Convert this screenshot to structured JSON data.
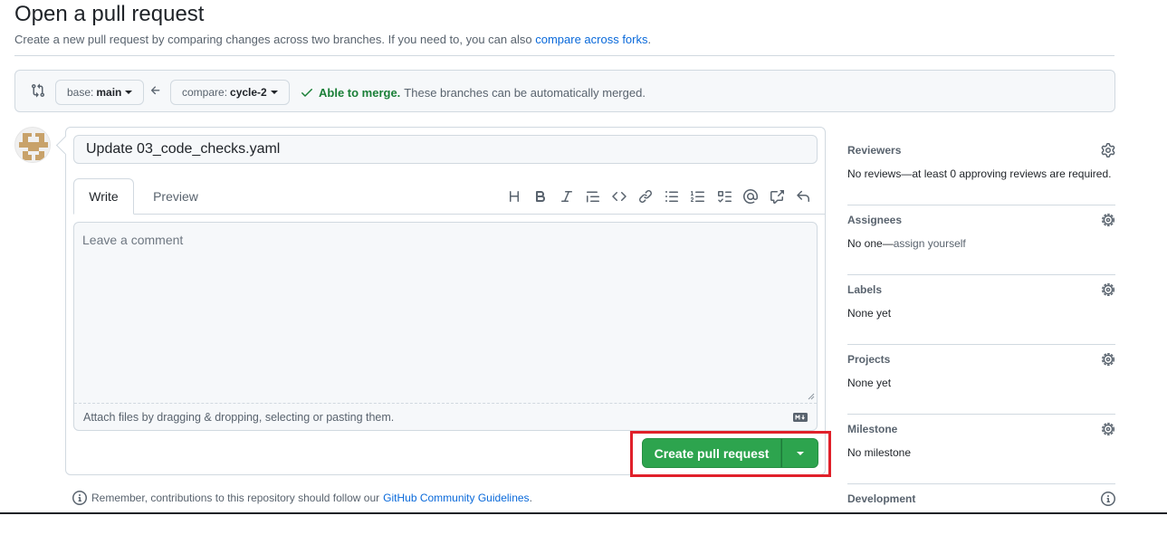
{
  "page": {
    "title": "Open a pull request",
    "subtitle_text": "Create a new pull request by comparing changes across two branches. If you need to, you can also",
    "subtitle_link": "compare across forks",
    "subtitle_end": "."
  },
  "range": {
    "base_prefix": "base:",
    "base_branch": "main",
    "compare_prefix": "compare:",
    "compare_branch": "cycle-2",
    "merge_ok": "Able to merge.",
    "merge_note": "These branches can be automatically merged."
  },
  "form": {
    "title_value": "Update 03_code_checks.yaml",
    "tabs": [
      "Write",
      "Preview"
    ],
    "comment_placeholder": "Leave a comment",
    "attach_text": "Attach files by dragging & dropping, selecting or pasting them.",
    "submit_label": "Create pull request"
  },
  "toolbar": {
    "icons": [
      "heading-icon",
      "bold-icon",
      "italic-icon",
      "quote-icon",
      "code-icon",
      "link-icon",
      "unordered-list-icon",
      "ordered-list-icon",
      "task-list-icon",
      "mention-icon",
      "cross-reference-icon",
      "reply-icon"
    ]
  },
  "guidelines": {
    "text": "Remember, contributions to this repository should follow our",
    "link": "GitHub Community Guidelines",
    "end": "."
  },
  "sidebar": {
    "reviewers": {
      "title": "Reviewers",
      "value": "No reviews—at least 0 approving reviews are required."
    },
    "assignees": {
      "title": "Assignees",
      "value": "No one—",
      "action": "assign yourself"
    },
    "labels": {
      "title": "Labels",
      "value": "None yet"
    },
    "projects": {
      "title": "Projects",
      "value": "None yet"
    },
    "milestone": {
      "title": "Milestone",
      "value": "No milestone"
    },
    "development": {
      "title": "Development"
    }
  },
  "colors": {
    "accent_link": "#0969da",
    "success": "#1a7f37",
    "button_green": "#2da44e",
    "highlight": "#e0202a"
  }
}
